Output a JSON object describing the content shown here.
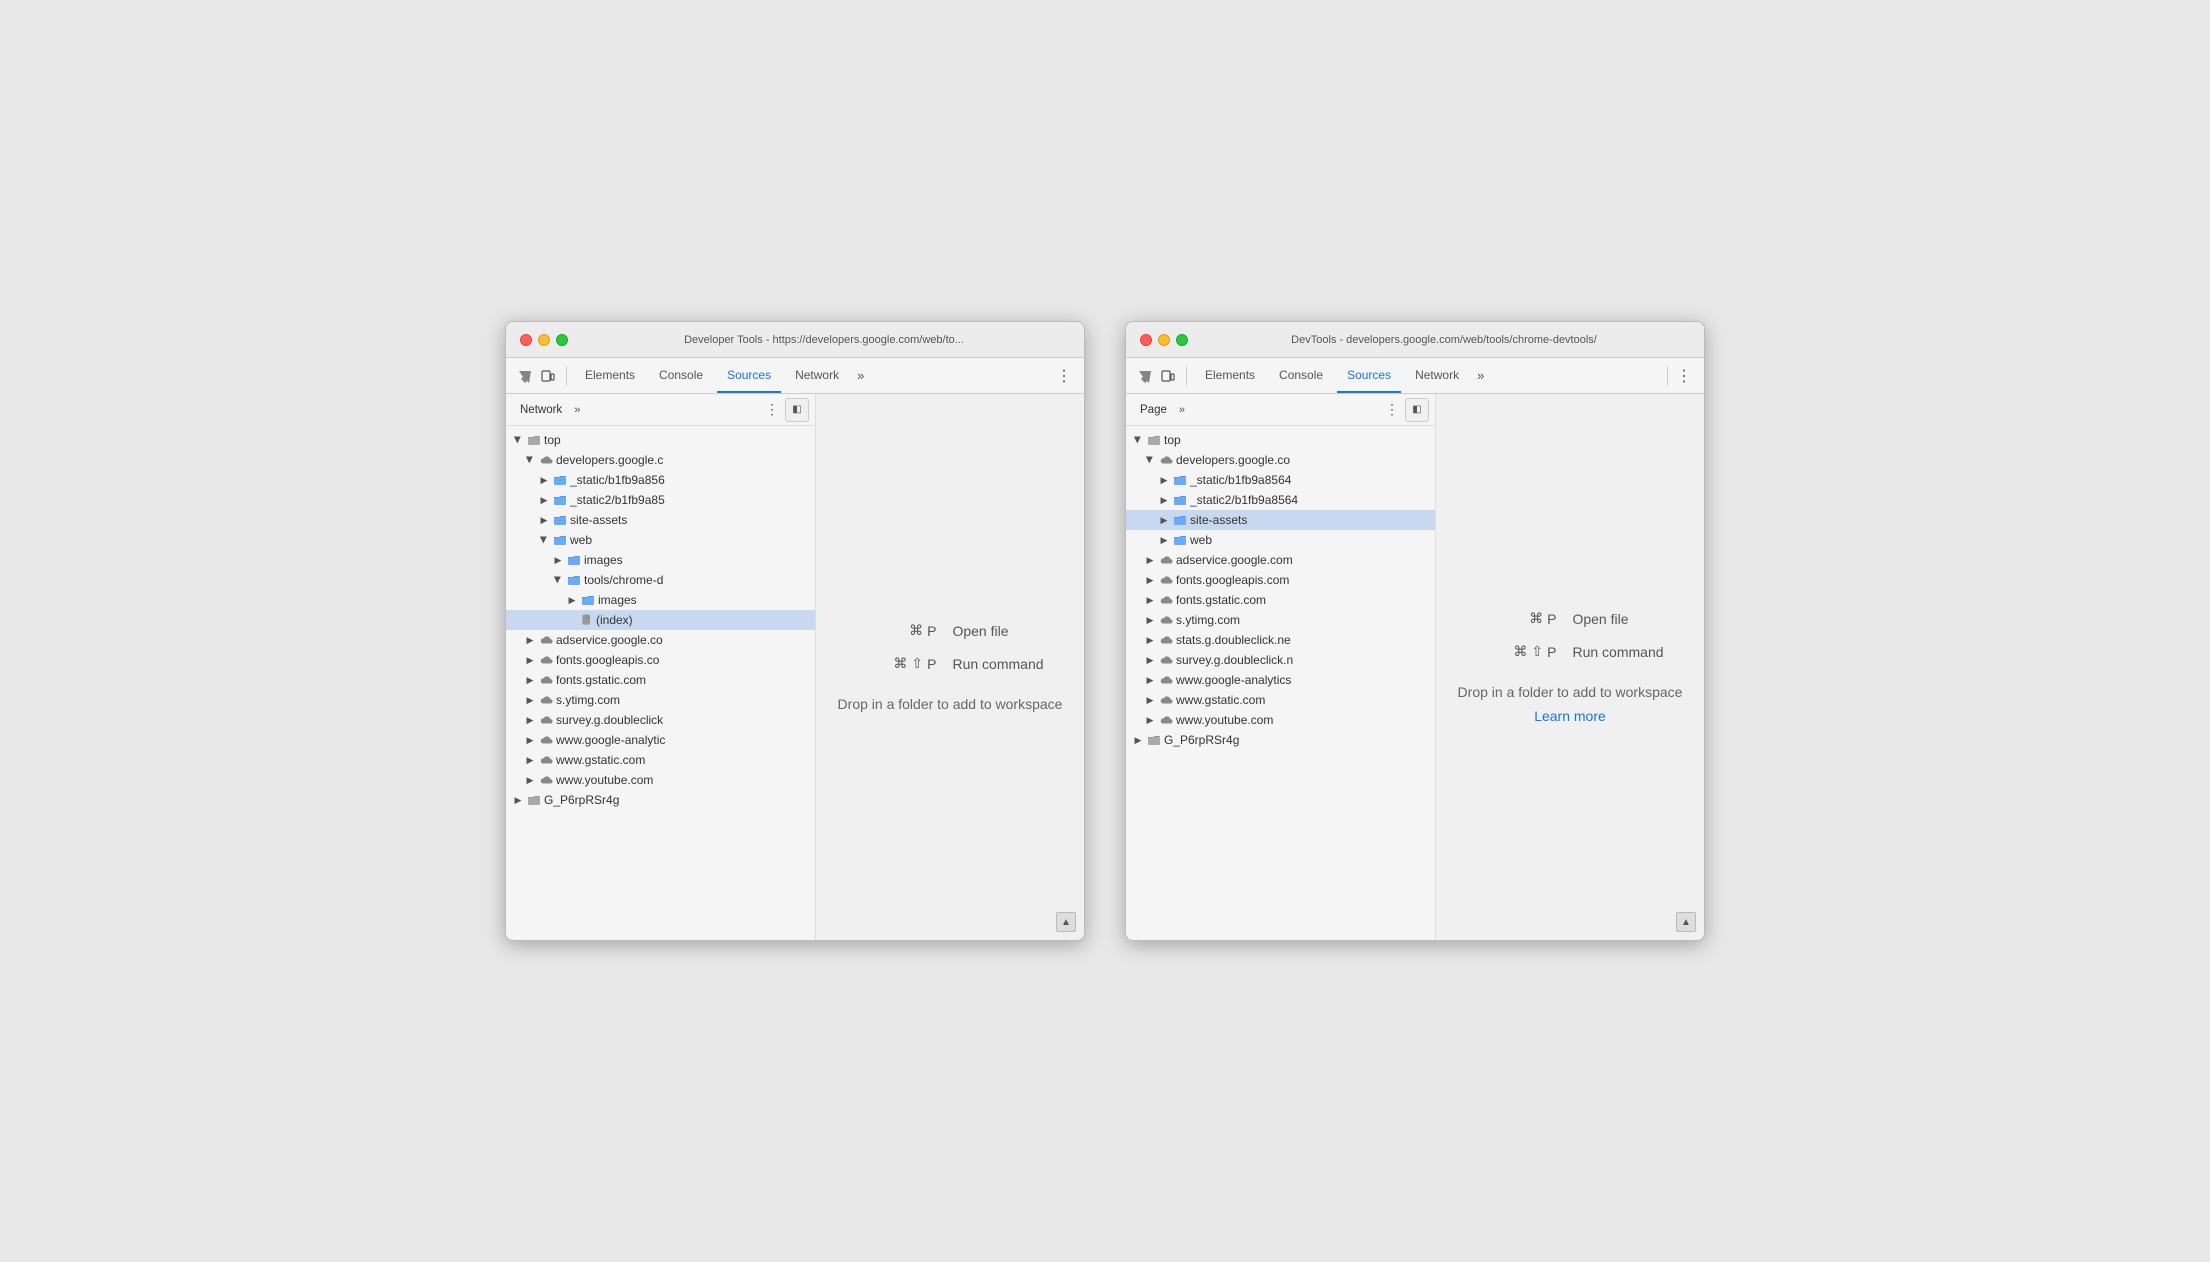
{
  "window1": {
    "titleBar": {
      "title": "Developer Tools - https://developers.google.com/web/to..."
    },
    "toolbar": {
      "tabs": [
        "Elements",
        "Console",
        "Sources",
        "Network"
      ],
      "activeTab": "Sources"
    },
    "leftPanel": {
      "tabs": [
        "Network"
      ],
      "activeTab": "Network",
      "moreLabel": "»",
      "tree": [
        {
          "id": "top",
          "label": "top",
          "indent": 0,
          "type": "folder-open",
          "icon": "folder-gray"
        },
        {
          "id": "developers",
          "label": "developers.google.c",
          "indent": 1,
          "type": "folder-open",
          "icon": "cloud"
        },
        {
          "id": "static1",
          "label": "_static/b1fb9a856",
          "indent": 2,
          "type": "folder-closed",
          "icon": "folder-blue"
        },
        {
          "id": "static2",
          "label": "_static2/b1fb9a85",
          "indent": 2,
          "type": "folder-closed",
          "icon": "folder-blue"
        },
        {
          "id": "siteassets",
          "label": "site-assets",
          "indent": 2,
          "type": "folder-closed",
          "icon": "folder-blue"
        },
        {
          "id": "web",
          "label": "web",
          "indent": 2,
          "type": "folder-open",
          "icon": "folder-blue"
        },
        {
          "id": "images",
          "label": "images",
          "indent": 3,
          "type": "folder-closed",
          "icon": "folder-blue"
        },
        {
          "id": "toolschrome",
          "label": "tools/chrome-d",
          "indent": 3,
          "type": "folder-open",
          "icon": "folder-blue"
        },
        {
          "id": "images2",
          "label": "images",
          "indent": 4,
          "type": "folder-closed",
          "icon": "folder-blue"
        },
        {
          "id": "index",
          "label": "(index)",
          "indent": 4,
          "type": "file",
          "icon": "file",
          "selected": true
        },
        {
          "id": "adservice",
          "label": "adservice.google.co",
          "indent": 1,
          "type": "folder-closed",
          "icon": "cloud"
        },
        {
          "id": "googleapis",
          "label": "fonts.googleapis.co",
          "indent": 1,
          "type": "folder-closed",
          "icon": "cloud"
        },
        {
          "id": "gstatic",
          "label": "fonts.gstatic.com",
          "indent": 1,
          "type": "folder-closed",
          "icon": "cloud"
        },
        {
          "id": "ytimg",
          "label": "s.ytimg.com",
          "indent": 1,
          "type": "folder-closed",
          "icon": "cloud"
        },
        {
          "id": "doubleclick",
          "label": "survey.g.doubleclick",
          "indent": 1,
          "type": "folder-closed",
          "icon": "cloud"
        },
        {
          "id": "analytics",
          "label": "www.google-analytic",
          "indent": 1,
          "type": "folder-closed",
          "icon": "cloud"
        },
        {
          "id": "gstatic2",
          "label": "www.gstatic.com",
          "indent": 1,
          "type": "folder-closed",
          "icon": "cloud"
        },
        {
          "id": "youtube",
          "label": "www.youtube.com",
          "indent": 1,
          "type": "folder-closed",
          "icon": "cloud"
        },
        {
          "id": "g_p6rp",
          "label": "G_P6rpRSr4g",
          "indent": 0,
          "type": "folder-closed",
          "icon": "folder-gray"
        }
      ]
    },
    "editor": {
      "openFileCmd": "Open file",
      "openFileKeys": "⌘ P",
      "runCmdLabel": "Run command",
      "runCmdKeys": "⌘ ⇧ P",
      "dropText": "Drop in a folder to add to workspace"
    }
  },
  "window2": {
    "titleBar": {
      "title": "DevTools - developers.google.com/web/tools/chrome-devtools/"
    },
    "toolbar": {
      "tabs": [
        "Elements",
        "Console",
        "Sources",
        "Network"
      ],
      "activeTab": "Sources"
    },
    "leftPanel": {
      "tabs": [
        "Page"
      ],
      "activeTab": "Page",
      "moreLabel": "»",
      "tree": [
        {
          "id": "top",
          "label": "top",
          "indent": 0,
          "type": "folder-open",
          "icon": "folder-gray"
        },
        {
          "id": "developers",
          "label": "developers.google.co",
          "indent": 1,
          "type": "folder-open",
          "icon": "cloud"
        },
        {
          "id": "static1",
          "label": "_static/b1fb9a8564",
          "indent": 2,
          "type": "folder-closed",
          "icon": "folder-blue"
        },
        {
          "id": "static2",
          "label": "_static2/b1fb9a8564",
          "indent": 2,
          "type": "folder-closed",
          "icon": "folder-blue"
        },
        {
          "id": "siteassets",
          "label": "site-assets",
          "indent": 2,
          "type": "folder-closed",
          "icon": "folder-blue",
          "selected": true
        },
        {
          "id": "web",
          "label": "web",
          "indent": 2,
          "type": "folder-closed",
          "icon": "folder-blue"
        },
        {
          "id": "adservice",
          "label": "adservice.google.com",
          "indent": 1,
          "type": "folder-closed",
          "icon": "cloud"
        },
        {
          "id": "googleapis",
          "label": "fonts.googleapis.com",
          "indent": 1,
          "type": "folder-closed",
          "icon": "cloud"
        },
        {
          "id": "gstatic",
          "label": "fonts.gstatic.com",
          "indent": 1,
          "type": "folder-closed",
          "icon": "cloud"
        },
        {
          "id": "ytimg",
          "label": "s.ytimg.com",
          "indent": 1,
          "type": "folder-closed",
          "icon": "cloud"
        },
        {
          "id": "doubleclick1",
          "label": "stats.g.doubleclick.ne",
          "indent": 1,
          "type": "folder-closed",
          "icon": "cloud"
        },
        {
          "id": "doubleclick2",
          "label": "survey.g.doubleclick.n",
          "indent": 1,
          "type": "folder-closed",
          "icon": "cloud"
        },
        {
          "id": "analytics",
          "label": "www.google-analytics",
          "indent": 1,
          "type": "folder-closed",
          "icon": "cloud"
        },
        {
          "id": "gstatic2",
          "label": "www.gstatic.com",
          "indent": 1,
          "type": "folder-closed",
          "icon": "cloud"
        },
        {
          "id": "youtube",
          "label": "www.youtube.com",
          "indent": 1,
          "type": "folder-closed",
          "icon": "cloud"
        },
        {
          "id": "g_p6rp",
          "label": "G_P6rpRSr4g",
          "indent": 0,
          "type": "folder-closed",
          "icon": "folder-gray"
        }
      ]
    },
    "editor": {
      "openFileCmd": "Open file",
      "openFileKeys": "⌘ P",
      "runCmdLabel": "Run command",
      "runCmdKeys": "⌘ ⇧ P",
      "dropText": "Drop in a folder to add to workspace",
      "learnMore": "Learn more"
    }
  }
}
